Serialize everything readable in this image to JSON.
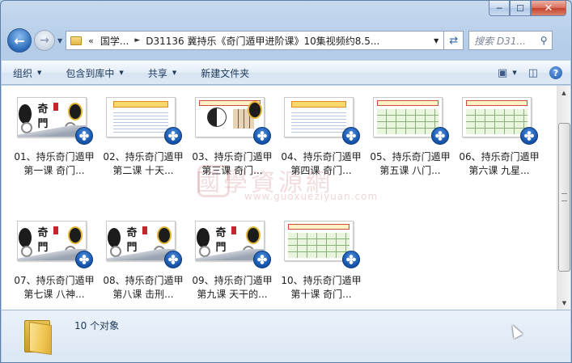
{
  "window": {
    "caption_buttons": {
      "minimize": "─",
      "maximize": "☐",
      "close": "✕"
    }
  },
  "nav": {
    "back_icon": "back-arrow-icon",
    "forward_icon": "forward-arrow-icon",
    "address": {
      "chevron": "«",
      "crumbs": [
        "国学...",
        "D31136 冀持乐《奇门遁甲进阶课》10集视频约8.5..."
      ]
    },
    "search_placeholder": "搜索 D31..."
  },
  "toolbar": {
    "organize": "组织",
    "include_library": "包含到库中",
    "share": "共享",
    "new_folder": "新建文件夹"
  },
  "watermark": {
    "text": "國學資源網",
    "url": "www.guoxueziyuan.com"
  },
  "files": [
    {
      "name": "01、持乐奇门遁甲第一课 奇门...",
      "thumb": "title-card"
    },
    {
      "name": "02、持乐奇门遁甲第二课 十天...",
      "thumb": "doc-lines"
    },
    {
      "name": "03、持乐奇门遁甲第三课 奇门...",
      "thumb": "yinyang"
    },
    {
      "name": "04、持乐奇门遁甲第四课 奇门...",
      "thumb": "doc-lines"
    },
    {
      "name": "05、持乐奇门遁甲第五课 八门...",
      "thumb": "doc-grid"
    },
    {
      "name": "06、持乐奇门遁甲第六课 九星...",
      "thumb": "doc-grid"
    },
    {
      "name": "07、持乐奇门遁甲第七课 八神...",
      "thumb": "title-card"
    },
    {
      "name": "08、持乐奇门遁甲第八课 击刑...",
      "thumb": "title-card"
    },
    {
      "name": "09、持乐奇门遁甲第九课 天干的...",
      "thumb": "title-card"
    },
    {
      "name": "10、持乐奇门遁甲第十课 奇门...",
      "thumb": "doc-grid"
    }
  ],
  "details": {
    "count_text": "10 个对象"
  },
  "colors": {
    "accent": "#2a69b8",
    "toolbar_text": "#1e395b",
    "seal_red": "#c3272b"
  }
}
